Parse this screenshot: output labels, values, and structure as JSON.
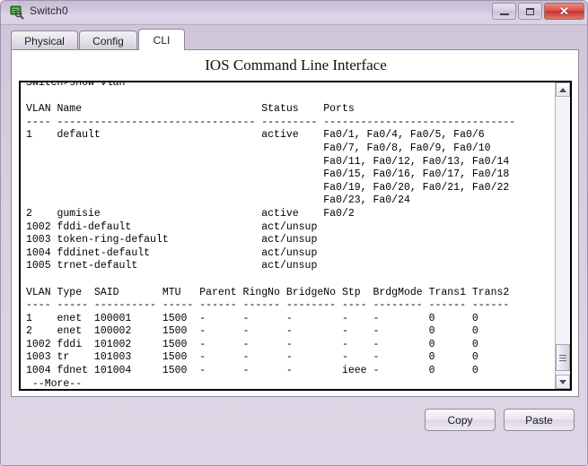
{
  "window": {
    "title": "Switch0",
    "icon": "switch-device-icon",
    "controls": {
      "minimize": "minimize-icon",
      "maximize": "maximize-icon",
      "close": "✕"
    }
  },
  "tabs": [
    {
      "label": "Physical",
      "name": "tab-physical",
      "active": false
    },
    {
      "label": "Config",
      "name": "tab-config",
      "active": false
    },
    {
      "label": "CLI",
      "name": "tab-cli",
      "active": true
    }
  ],
  "panel": {
    "heading": "IOS Command Line Interface"
  },
  "terminal": {
    "prompt_line": "Switch>show vlan",
    "more_prompt": "--More--",
    "vlan_table": {
      "headers": [
        "VLAN",
        "Name",
        "Status",
        "Ports"
      ],
      "separator": "---- -------------------------------- --------- -------------------------------",
      "rows": [
        {
          "vlan": "1",
          "name": "default",
          "status": "active",
          "ports": [
            "Fa0/1, Fa0/4, Fa0/5, Fa0/6",
            "Fa0/7, Fa0/8, Fa0/9, Fa0/10",
            "Fa0/11, Fa0/12, Fa0/13, Fa0/14",
            "Fa0/15, Fa0/16, Fa0/17, Fa0/18",
            "Fa0/19, Fa0/20, Fa0/21, Fa0/22",
            "Fa0/23, Fa0/24"
          ]
        },
        {
          "vlan": "2",
          "name": "gumisie",
          "status": "active",
          "ports": [
            "Fa0/2"
          ]
        },
        {
          "vlan": "1002",
          "name": "fddi-default",
          "status": "act/unsup",
          "ports": []
        },
        {
          "vlan": "1003",
          "name": "token-ring-default",
          "status": "act/unsup",
          "ports": []
        },
        {
          "vlan": "1004",
          "name": "fddinet-default",
          "status": "act/unsup",
          "ports": []
        },
        {
          "vlan": "1005",
          "name": "trnet-default",
          "status": "act/unsup",
          "ports": []
        }
      ]
    },
    "detail_table": {
      "headers": [
        "VLAN",
        "Type",
        "SAID",
        "MTU",
        "Parent",
        "RingNo",
        "BridgeNo",
        "Stp",
        "BrdgMode",
        "Trans1",
        "Trans2"
      ],
      "separator": "---- ----- ---------- ----- ------ ------ -------- ---- -------- ------ ------",
      "rows": [
        {
          "vlan": "1",
          "type": "enet",
          "said": "100001",
          "mtu": "1500",
          "parent": "-",
          "ringno": "-",
          "bridgeno": "-",
          "stp": "-",
          "brdgmode": "-",
          "trans1": "0",
          "trans2": "0"
        },
        {
          "vlan": "2",
          "type": "enet",
          "said": "100002",
          "mtu": "1500",
          "parent": "-",
          "ringno": "-",
          "bridgeno": "-",
          "stp": "-",
          "brdgmode": "-",
          "trans1": "0",
          "trans2": "0"
        },
        {
          "vlan": "1002",
          "type": "fddi",
          "said": "101002",
          "mtu": "1500",
          "parent": "-",
          "ringno": "-",
          "bridgeno": "-",
          "stp": "-",
          "brdgmode": "-",
          "trans1": "0",
          "trans2": "0"
        },
        {
          "vlan": "1003",
          "type": "tr",
          "said": "101003",
          "mtu": "1500",
          "parent": "-",
          "ringno": "-",
          "bridgeno": "-",
          "stp": "-",
          "brdgmode": "-",
          "trans1": "0",
          "trans2": "0"
        },
        {
          "vlan": "1004",
          "type": "fdnet",
          "said": "101004",
          "mtu": "1500",
          "parent": "-",
          "ringno": "-",
          "bridgeno": "-",
          "stp": "ieee",
          "brdgmode": "-",
          "trans1": "0",
          "trans2": "0"
        }
      ]
    },
    "rendered": "Switch>show vlan\n\nVLAN Name                             Status    Ports\n---- -------------------------------- --------- -------------------------------\n1    default                          active    Fa0/1, Fa0/4, Fa0/5, Fa0/6\n                                                Fa0/7, Fa0/8, Fa0/9, Fa0/10\n                                                Fa0/11, Fa0/12, Fa0/13, Fa0/14\n                                                Fa0/15, Fa0/16, Fa0/17, Fa0/18\n                                                Fa0/19, Fa0/20, Fa0/21, Fa0/22\n                                                Fa0/23, Fa0/24\n2    gumisie                          active    Fa0/2\n1002 fddi-default                     act/unsup\n1003 token-ring-default               act/unsup\n1004 fddinet-default                  act/unsup\n1005 trnet-default                    act/unsup\n\nVLAN Type  SAID       MTU   Parent RingNo BridgeNo Stp  BrdgMode Trans1 Trans2\n---- ----- ---------- ----- ------ ------ -------- ---- -------- ------ ------\n1    enet  100001     1500  -      -      -        -    -        0      0\n2    enet  100002     1500  -      -      -        -    -        0      0\n1002 fddi  101002     1500  -      -      -        -    -        0      0\n1003 tr    101003     1500  -      -      -        -    -        0      0\n1004 fdnet 101004     1500  -      -      -        ieee -        0      0\n --More--"
  },
  "scrollbar": {
    "up_arrow": "scroll-up-icon",
    "down_arrow": "scroll-down-icon"
  },
  "footer": {
    "copy_label": "Copy",
    "paste_label": "Paste"
  },
  "colors": {
    "window_chrome": "#d5cce0",
    "close_button": "#d9544c",
    "panel_background": "#ffffff",
    "terminal_text": "#000000"
  }
}
